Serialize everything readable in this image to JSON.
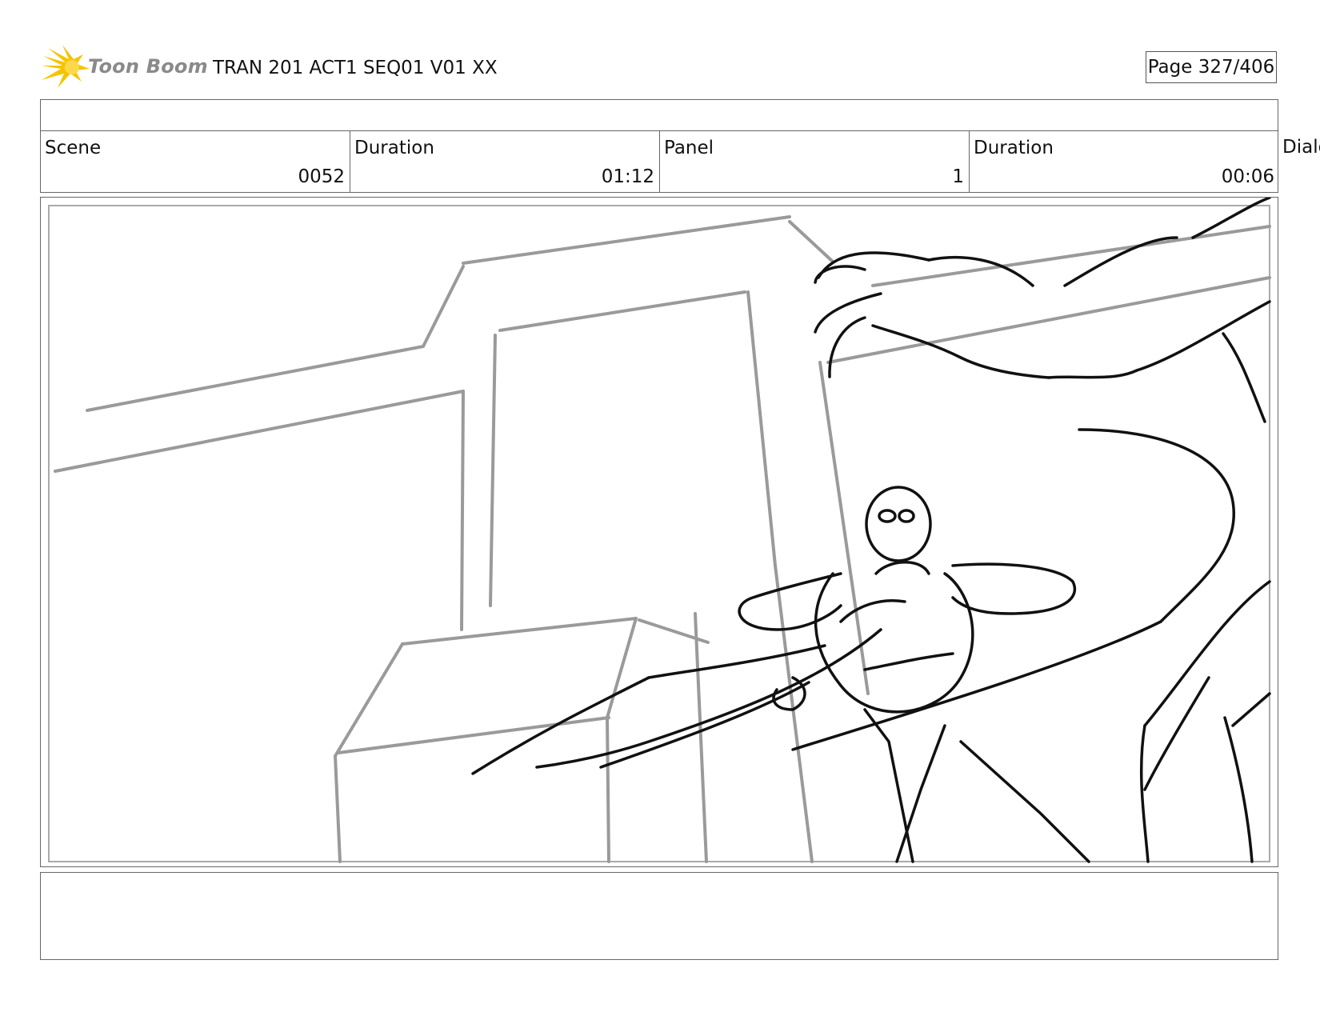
{
  "header": {
    "brand": "Toon Boom",
    "project_title": "TRAN 201 ACT1 SEQ01 V01 XX",
    "page_indicator": "Page 327/406"
  },
  "info": {
    "scene_label": "Scene",
    "scene_value": "0052",
    "scene_duration_label": "Duration",
    "scene_duration_value": "01:12",
    "panel_label": "Panel",
    "panel_value": "1",
    "panel_duration_label": "Duration",
    "panel_duration_value": "00:06",
    "dialog_label_partial": "Dialo"
  },
  "colors": {
    "logo_burst": "#f5c400",
    "sketch_gray": "#9a9a9a",
    "sketch_black": "#111111"
  },
  "icons": {
    "logo": "toon-boom-burst-icon"
  }
}
